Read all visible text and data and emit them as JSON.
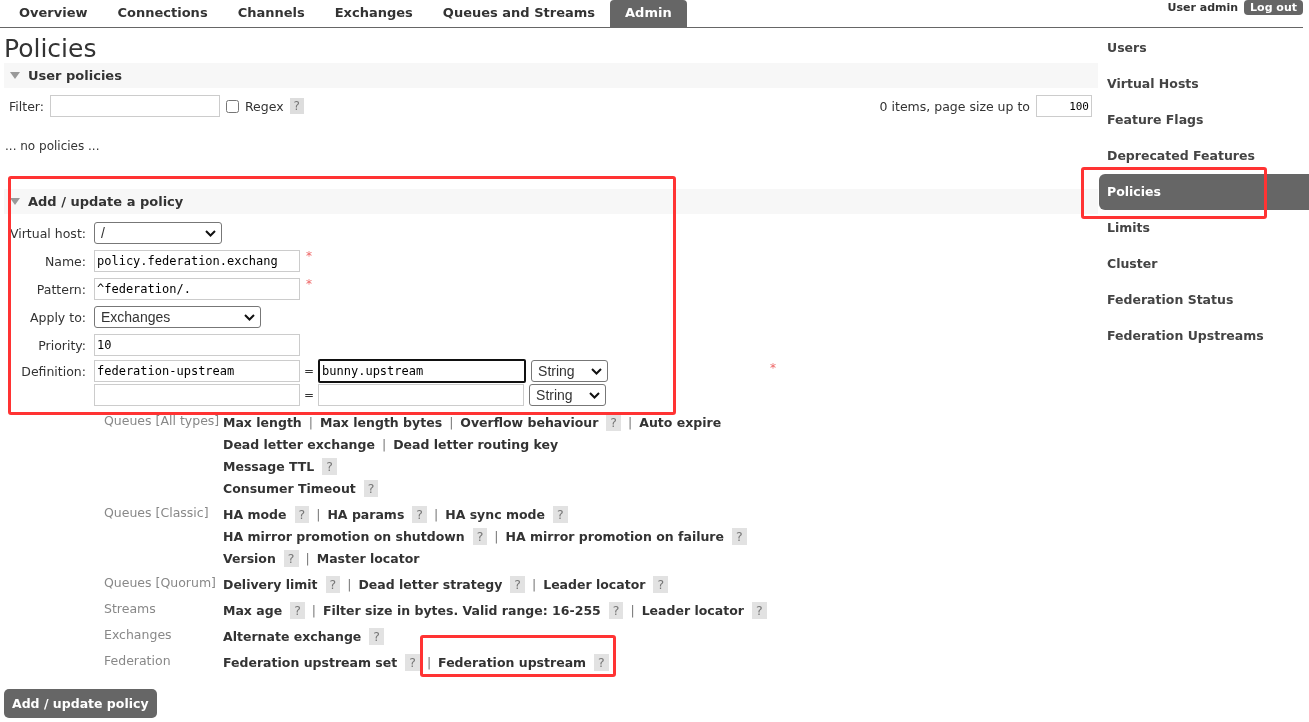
{
  "tabs": [
    {
      "label": "Overview",
      "selected": false
    },
    {
      "label": "Connections",
      "selected": false
    },
    {
      "label": "Channels",
      "selected": false
    },
    {
      "label": "Exchanges",
      "selected": false
    },
    {
      "label": "Queues and Streams",
      "selected": false
    },
    {
      "label": "Admin",
      "selected": true
    }
  ],
  "user": {
    "label": "User admin",
    "logout": "Log out"
  },
  "page_title": "Policies",
  "user_policies": {
    "title": "User policies",
    "filter_label": "Filter:",
    "regex": {
      "label": "Regex",
      "checked": false
    },
    "help": "?",
    "paging": "0 items, page size up to",
    "page_size": "100",
    "empty": "... no policies ..."
  },
  "form": {
    "title": "Add / update a policy",
    "required": "*",
    "fields": [
      {
        "kind": "select",
        "label": "Virtual host:",
        "value": "/",
        "required": false
      },
      {
        "kind": "text",
        "label": "Name:",
        "value": "policy.federation.exchang",
        "required": true
      },
      {
        "kind": "text",
        "label": "Pattern:",
        "value": "^federation/.",
        "required": true
      },
      {
        "kind": "select",
        "label": "Apply to:",
        "value": "Exchanges",
        "required": false
      },
      {
        "kind": "text",
        "label": "Priority:",
        "value": "10",
        "required": false
      }
    ],
    "definition": {
      "label": "Definition:",
      "equals": "=",
      "rows": [
        {
          "key": "federation-upstream",
          "value": "bunny.upstream",
          "type": "String",
          "focused": true
        },
        {
          "key": "",
          "value": "",
          "type": "String",
          "focused": false
        }
      ]
    },
    "separator": "|",
    "groups": [
      {
        "label": "Queues [All types]",
        "lines": [
          [
            {
              "kind": "key",
              "text": "Max length"
            },
            {
              "kind": "key",
              "text": "Max length bytes"
            },
            {
              "kind": "key",
              "text": "Overflow behaviour"
            },
            {
              "kind": "help",
              "text": "?"
            },
            {
              "kind": "key",
              "text": "Auto expire"
            }
          ],
          [
            {
              "kind": "key",
              "text": "Dead letter exchange"
            },
            {
              "kind": "key",
              "text": "Dead letter routing key"
            }
          ],
          [
            {
              "kind": "key",
              "text": "Message TTL"
            },
            {
              "kind": "help",
              "text": "?"
            }
          ],
          [
            {
              "kind": "key",
              "text": "Consumer Timeout"
            },
            {
              "kind": "help",
              "text": "?"
            }
          ]
        ]
      },
      {
        "label": "Queues [Classic]",
        "lines": [
          [
            {
              "kind": "key",
              "text": "HA mode"
            },
            {
              "kind": "help",
              "text": "?"
            },
            {
              "kind": "key",
              "text": "HA params"
            },
            {
              "kind": "help",
              "text": "?"
            },
            {
              "kind": "key",
              "text": "HA sync mode"
            },
            {
              "kind": "help",
              "text": "?"
            }
          ],
          [
            {
              "kind": "key",
              "text": "HA mirror promotion on shutdown"
            },
            {
              "kind": "help",
              "text": "?"
            },
            {
              "kind": "key",
              "text": "HA mirror promotion on failure"
            },
            {
              "kind": "help",
              "text": "?"
            }
          ],
          [
            {
              "kind": "key",
              "text": "Version"
            },
            {
              "kind": "help",
              "text": "?"
            },
            {
              "kind": "key",
              "text": "Master locator"
            }
          ]
        ]
      },
      {
        "label": "Queues [Quorum]",
        "lines": [
          [
            {
              "kind": "key",
              "text": "Delivery limit"
            },
            {
              "kind": "help",
              "text": "?"
            },
            {
              "kind": "key",
              "text": "Dead letter strategy"
            },
            {
              "kind": "help",
              "text": "?"
            },
            {
              "kind": "key",
              "text": "Leader locator"
            },
            {
              "kind": "help",
              "text": "?"
            }
          ]
        ]
      },
      {
        "label": "Streams",
        "lines": [
          [
            {
              "kind": "key",
              "text": "Max age"
            },
            {
              "kind": "help",
              "text": "?"
            },
            {
              "kind": "key",
              "text": "Filter size in bytes. Valid range: 16-255"
            },
            {
              "kind": "help",
              "text": "?"
            },
            {
              "kind": "key",
              "text": "Leader locator"
            },
            {
              "kind": "help",
              "text": "?"
            }
          ]
        ]
      },
      {
        "label": "Exchanges",
        "lines": [
          [
            {
              "kind": "key",
              "text": "Alternate exchange"
            },
            {
              "kind": "help",
              "text": "?"
            }
          ]
        ]
      },
      {
        "label": "Federation",
        "lines": [
          [
            {
              "kind": "key",
              "text": "Federation upstream set"
            },
            {
              "kind": "help",
              "text": "?"
            },
            {
              "kind": "key",
              "text": "Federation upstream"
            },
            {
              "kind": "help",
              "text": "?"
            }
          ]
        ]
      }
    ],
    "submit": "Add / update policy"
  },
  "sidebar": {
    "items": [
      {
        "label": "Users",
        "selected": false
      },
      {
        "label": "Virtual Hosts",
        "selected": false
      },
      {
        "label": "Feature Flags",
        "selected": false
      },
      {
        "label": "Deprecated Features",
        "selected": false
      },
      {
        "label": "Policies",
        "selected": true
      },
      {
        "label": "Limits",
        "selected": false
      },
      {
        "label": "Cluster",
        "selected": false
      },
      {
        "label": "Federation Status",
        "selected": false
      },
      {
        "label": "Federation Upstreams",
        "selected": false
      }
    ]
  }
}
